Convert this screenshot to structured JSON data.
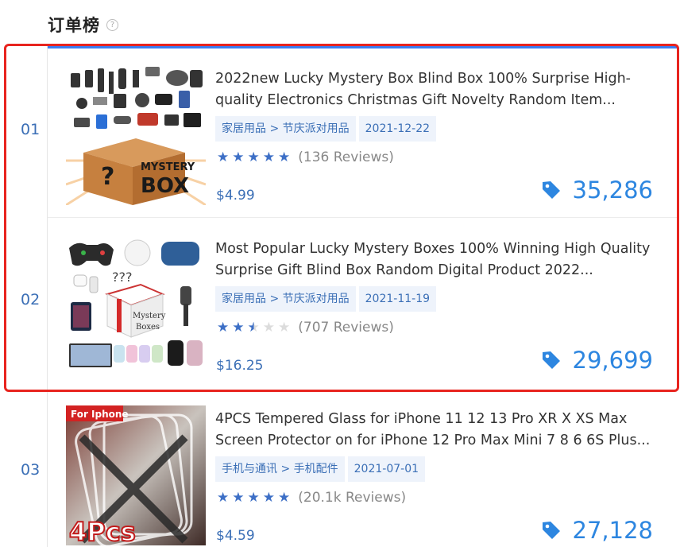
{
  "header": {
    "title": "订单榜",
    "help_icon": "question-circle-icon"
  },
  "colors": {
    "accent_blue": "#3c7df0",
    "rank_blue": "#3b6fb6",
    "count_blue": "#2d86e0",
    "highlight_red": "#e8241f",
    "star_blue": "#3d6fc6"
  },
  "products": [
    {
      "rank": "01",
      "title": "2022new Lucky Mystery Box Blind Box 100% Surprise High-quality Electronics Christmas Gift Novelty Random Item...",
      "category": "家居用品 > 节庆派对用品",
      "date": "2021-12-22",
      "rating": 5,
      "reviews": "(136 Reviews)",
      "price": "$4.99",
      "orders": "35,286",
      "image_text": "MYSTERY BOX"
    },
    {
      "rank": "02",
      "title": "Most Popular Lucky Mystery Boxes 100% Winning High Quality Surprise Gift Blind Box Random Digital Product 2022...",
      "category": "家居用品 > 节庆派对用品",
      "date": "2021-11-19",
      "rating": 2.5,
      "reviews": "(707 Reviews)",
      "price": "$16.25",
      "orders": "29,699",
      "image_text": "Mystery Boxes"
    },
    {
      "rank": "03",
      "title": "4PCS Tempered Glass for iPhone 11 12 13 Pro XR X XS Max Screen Protector on for iPhone 12 Pro Max Mini 7 8 6 6S Plus...",
      "category": "手机与通讯 > 手机配件",
      "date": "2021-07-01",
      "rating": 5,
      "reviews": "(20.1k Reviews)",
      "price": "$4.59",
      "orders": "27,128",
      "image_text": "For Iphone",
      "image_badge": "4Pcs"
    }
  ]
}
